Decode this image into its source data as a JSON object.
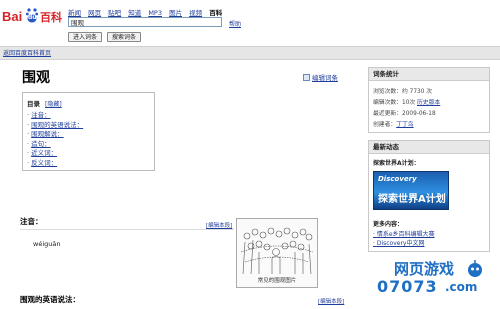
{
  "logo": {
    "text_bai": "Bai",
    "text_du": "du",
    "text_baike": "百科"
  },
  "nav": [
    "新闻",
    "网页",
    "贴吧",
    "知道",
    "MP3",
    "图片",
    "视频",
    "百科"
  ],
  "search": {
    "value": "围观",
    "help": "帮助",
    "enter_btn": "进入词条",
    "search_btn": "搜索词条"
  },
  "breadcrumb": "返回百度百科首页",
  "entry": {
    "title": "围观",
    "edit_link": "编辑词条",
    "toc": {
      "heading": "目录",
      "hide": "[隐藏]",
      "items": [
        "注音：",
        "围观的英语说法：",
        "围观解说：",
        "造句：",
        "近义词：",
        "反义词："
      ]
    },
    "sections": {
      "zhuyin": {
        "heading": "注音：",
        "edit": "[编辑本段]",
        "pinyin": "wéiguān"
      },
      "english": {
        "heading": "围观的英语说法：",
        "edit": "[编辑本段]"
      }
    },
    "image_caption": "常见的围观图片"
  },
  "sidebar": {
    "stats": {
      "heading": "词条统计",
      "views_label": "浏览次数：约",
      "views_value": "7730",
      "views_unit": "次",
      "edits_label": "编辑次数：",
      "edits_value": "10次",
      "history": "历史版本",
      "updated_label": "最近更新：",
      "updated_value": "2009-06-18",
      "creator_label": "创建者：",
      "creator_value": "丁丁鸟"
    },
    "news": {
      "heading": "最新动态",
      "explore_title": "探索世界A计划：",
      "discovery_text": "Discovery",
      "discovery_cn": "探索世界A计划",
      "more_label": "更多内容：",
      "more_links": [
        "情系e乡百科编辑大赛",
        "Discovery中文网"
      ]
    }
  },
  "watermark": {
    "cn": "网页游戏",
    "num": "07073",
    "dotcom": ".com"
  },
  "colors": {
    "link": "#1f3d9a",
    "baidu_red": "#d8232a",
    "baidu_blue": "#2a56c6",
    "watermark_blue": "#1f6fc4"
  }
}
